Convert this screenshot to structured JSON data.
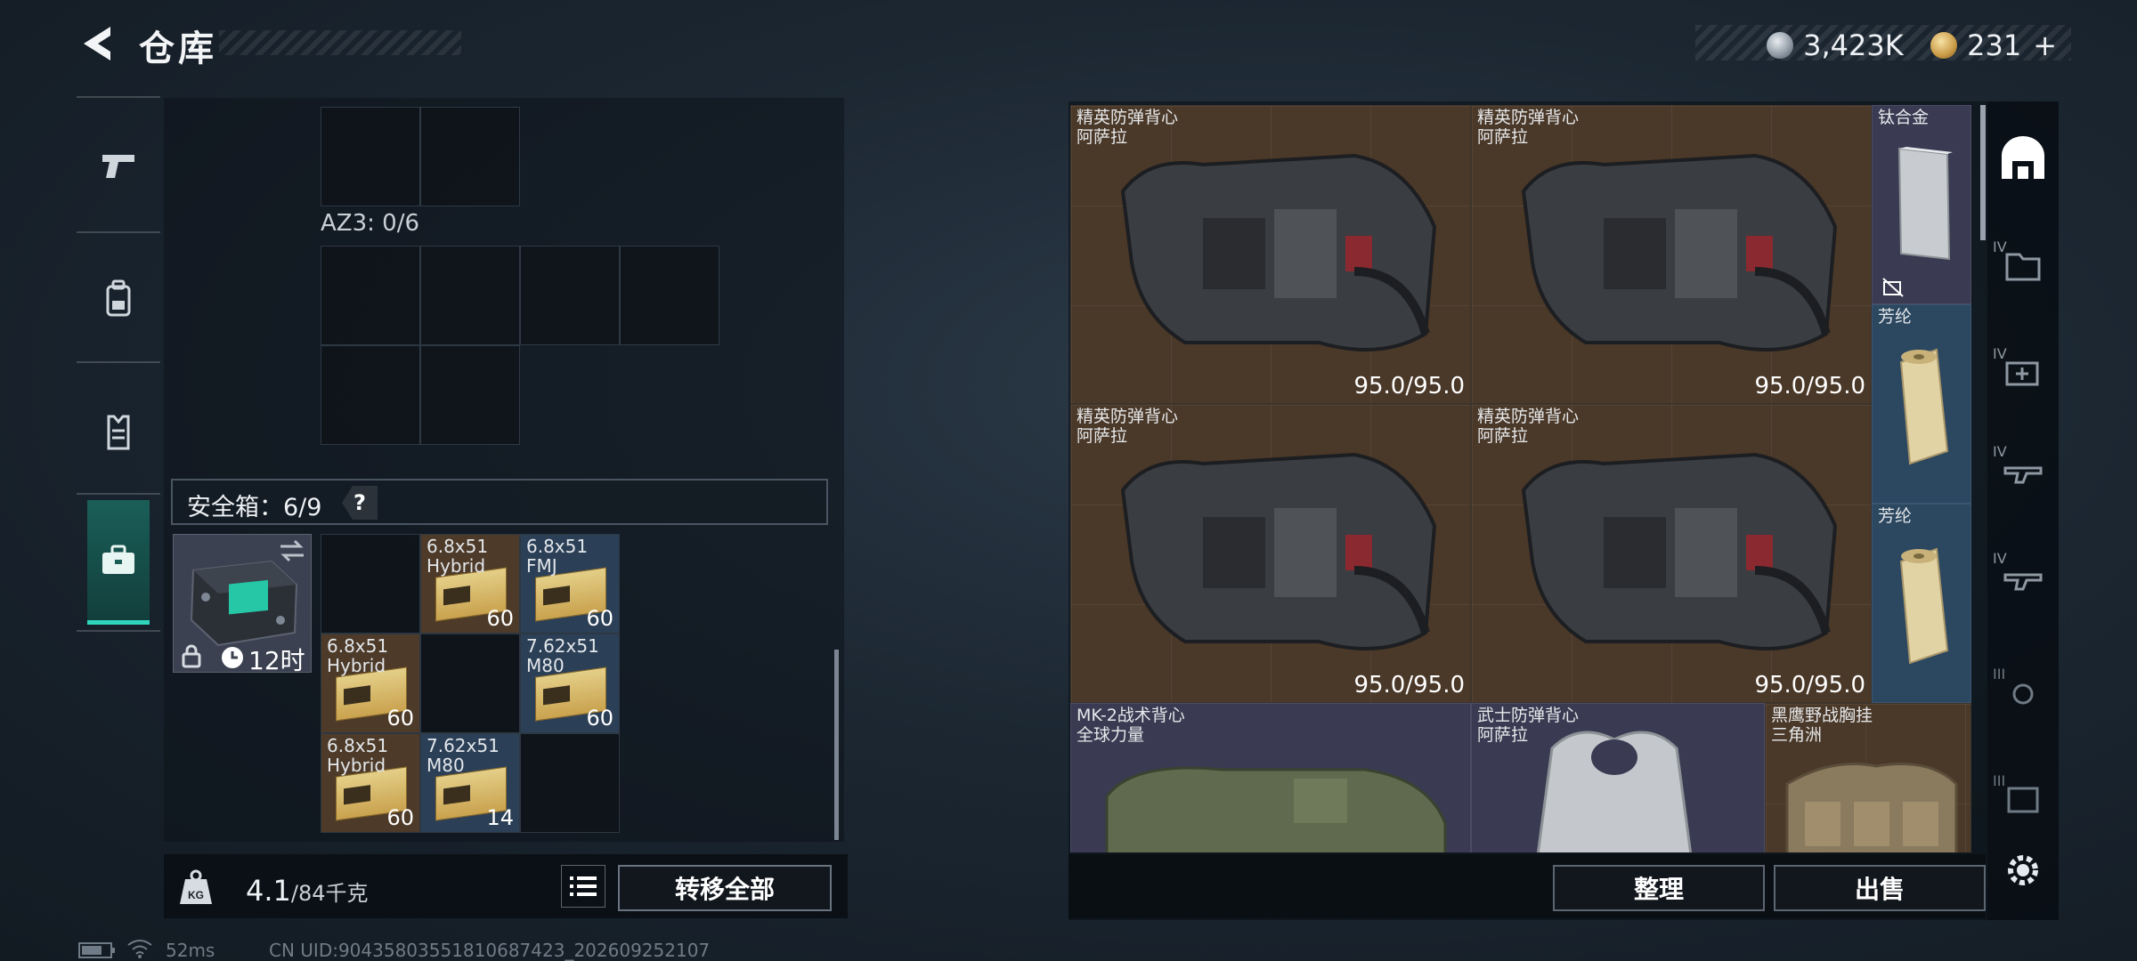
{
  "header": {
    "title": "仓库",
    "currency_silver": "3,423K",
    "currency_gold": "231",
    "plus_label": "+"
  },
  "left": {
    "az3_label": "AZ3: 0/6",
    "safe_label": "安全箱：6/9",
    "safe_help": "?",
    "safebox_timer": "12时",
    "ammo": [
      {
        "name": "6.8x51\nHybrid",
        "count": "60",
        "color": "brown"
      },
      {
        "name": "6.8x51\nFMJ",
        "count": "60",
        "color": "blue"
      },
      {
        "name": "6.8x51\nHybrid",
        "count": "60",
        "color": "brown"
      },
      {
        "name": "7.62x51\nM80",
        "count": "60",
        "color": "blue"
      },
      {
        "name": "6.8x51\nHybrid",
        "count": "60",
        "color": "brown"
      },
      {
        "name": "7.62x51\nM80",
        "count": "14",
        "color": "blue"
      }
    ],
    "weight_value": "4.1",
    "weight_max": "/84千克",
    "transfer_all": "转移全部"
  },
  "storage": {
    "items": [
      {
        "name": "精英防弹背心\n阿萨拉",
        "durability": "95.0/95.0"
      },
      {
        "name": "精英防弹背心\n阿萨拉",
        "durability": "95.0/95.0"
      },
      {
        "name": "精英防弹背心\n阿萨拉",
        "durability": "95.0/95.0"
      },
      {
        "name": "精英防弹背心\n阿萨拉",
        "durability": "95.0/95.0"
      },
      {
        "name": "钛合金",
        "durability": ""
      },
      {
        "name": "芳纶",
        "durability": ""
      },
      {
        "name": "芳纶",
        "durability": ""
      },
      {
        "name": "MK-2战术背心\n全球力量",
        "durability": ""
      },
      {
        "name": "武士防弹背心\n阿萨拉",
        "durability": ""
      },
      {
        "name": "黑鹰野战胸挂\n三角洲",
        "durability": ""
      }
    ],
    "organize": "整理",
    "sell": "出售"
  },
  "rail": {
    "tiers": [
      "IV",
      "IV",
      "IV",
      "IV",
      "III",
      "III"
    ]
  },
  "status": {
    "ping": "52ms",
    "uid": "CN UID:90435803551810687423_202609252107"
  },
  "colors": {
    "accent_teal": "#2fd5bd",
    "rarity_brown": "#4a3828",
    "rarity_blue": "#2c4760",
    "rarity_purple": "#3a3a52"
  }
}
